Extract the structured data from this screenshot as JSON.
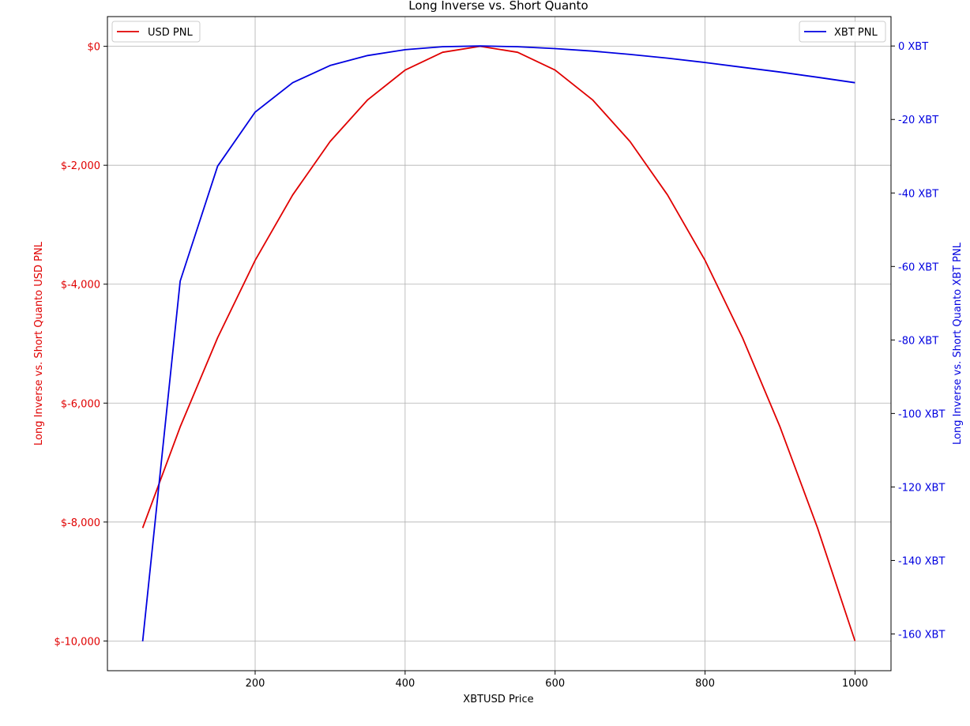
{
  "chart_data": {
    "type": "line",
    "title": "Long Inverse vs. Short Quanto",
    "xlabel": "XBTUSD Price",
    "ylabel_left": "Long Inverse vs. Short Quanto USD PNL",
    "ylabel_right": "Long Inverse vs. Short Quanto XBT PNL",
    "xlim": [
      3,
      1048
    ],
    "ylim_left": [
      -10500,
      500
    ],
    "ylim_right": [
      -170,
      8
    ],
    "x_ticks": [
      200,
      400,
      600,
      800,
      1000
    ],
    "x_tick_labels": [
      "200",
      "400",
      "600",
      "800",
      "1000"
    ],
    "y_left_ticks": [
      0,
      -2000,
      -4000,
      -6000,
      -8000,
      -10000
    ],
    "y_left_tick_labels": [
      "$0",
      "$-2,000",
      "$-4,000",
      "$-6,000",
      "$-8,000",
      "$-10,000"
    ],
    "y_right_ticks": [
      0,
      -20,
      -40,
      -60,
      -80,
      -100,
      -120,
      -140,
      -160
    ],
    "y_right_tick_labels": [
      "0 XBT",
      "-20 XBT",
      "-40 XBT",
      "-60 XBT",
      "-80 XBT",
      "-100 XBT",
      "-120 XBT",
      "-140 XBT",
      "-160 XBT"
    ],
    "grid": true,
    "x": [
      50,
      100,
      150,
      200,
      250,
      300,
      350,
      400,
      450,
      500,
      550,
      600,
      650,
      700,
      750,
      800,
      850,
      900,
      950,
      1000
    ],
    "series": [
      {
        "name": "USD PNL",
        "axis": "left",
        "color": "#e00000",
        "legend_position": "top-left",
        "values": [
          -8100,
          -6400,
          -4900,
          -3600,
          -2500,
          -1600,
          -900,
          -400,
          -100,
          0,
          -100,
          -400,
          -900,
          -1600,
          -2500,
          -3600,
          -4900,
          -6400,
          -8100,
          -10000
        ]
      },
      {
        "name": "XBT PNL",
        "axis": "right",
        "color": "#0000e0",
        "legend_position": "top-right",
        "values": [
          -162,
          -64,
          -32.7,
          -18,
          -10,
          -5.3,
          -2.6,
          -1,
          -0.2,
          0,
          -0.2,
          -0.7,
          -1.4,
          -2.3,
          -3.3,
          -4.5,
          -5.8,
          -7.1,
          -8.5,
          -10
        ]
      }
    ]
  }
}
